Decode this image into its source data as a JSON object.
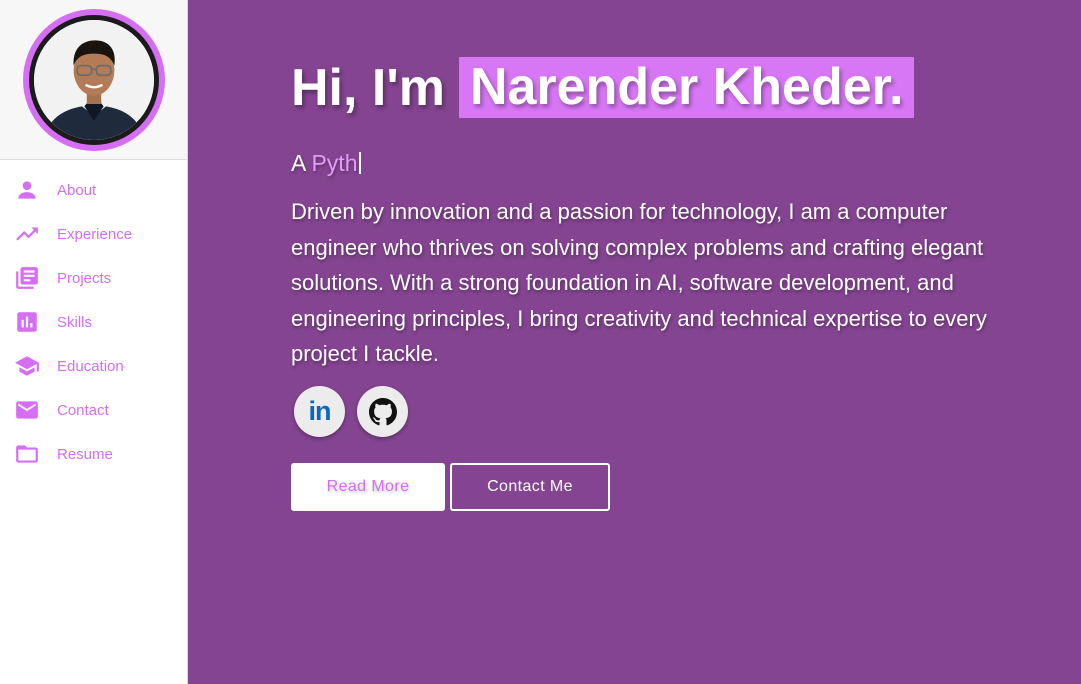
{
  "sidebar": {
    "items": [
      {
        "label": "About",
        "icon": "person-icon"
      },
      {
        "label": "Experience",
        "icon": "trending-up-icon"
      },
      {
        "label": "Projects",
        "icon": "library-books-icon"
      },
      {
        "label": "Skills",
        "icon": "bar-chart-icon"
      },
      {
        "label": "Education",
        "icon": "graduation-cap-icon"
      },
      {
        "label": "Contact",
        "icon": "mail-icon"
      },
      {
        "label": "Resume",
        "icon": "folder-icon"
      }
    ]
  },
  "hero": {
    "greeting": "Hi, I'm",
    "name": "Narender Kheder.",
    "typing_prefix": "A",
    "typing_text": "Pyth",
    "bio": "Driven by innovation and a passion for technology, I am a computer engineer who thrives on solving complex problems and crafting elegant solutions. With a strong foundation in AI, software development, and engineering principles, I bring creativity and technical expertise to every project I tackle."
  },
  "socials": {
    "linkedin": {
      "label": "in",
      "icon": "linkedin-icon"
    },
    "github": {
      "icon": "github-icon"
    }
  },
  "buttons": {
    "read_more": "Read More",
    "contact_me": "Contact Me"
  },
  "colors": {
    "accent": "#d56ef2",
    "main_bg": "#844491",
    "name_highlight": "#d877f5"
  }
}
